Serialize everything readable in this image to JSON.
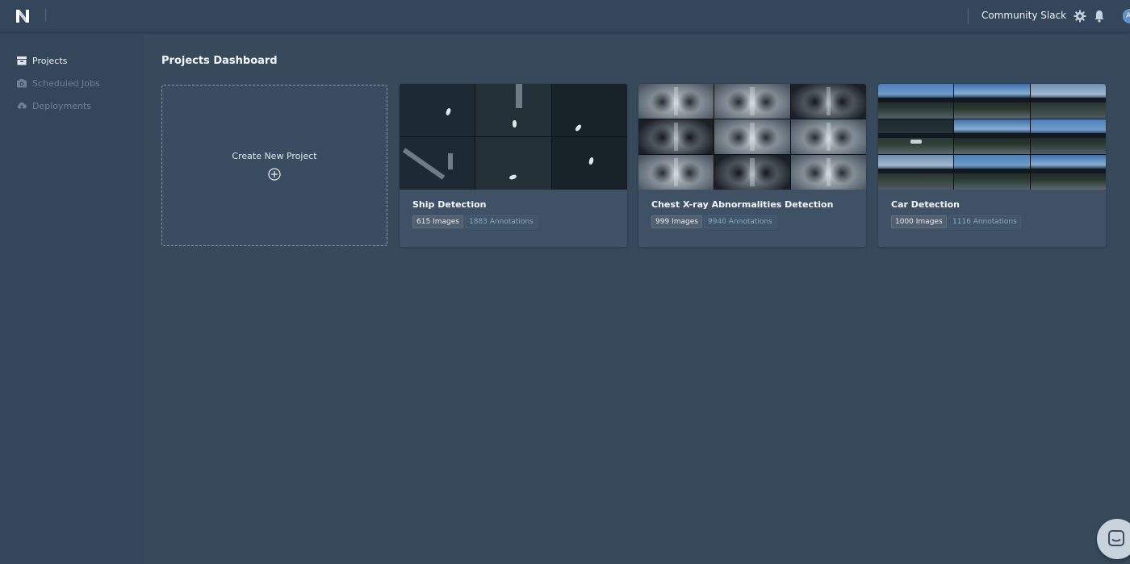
{
  "app": {
    "logo_letter": "N"
  },
  "topbar": {
    "community_label": "Community Slack",
    "avatar_initial": "A"
  },
  "sidebar": {
    "items": [
      {
        "label": "Projects",
        "icon": "inbox-icon",
        "active": true
      },
      {
        "label": "Scheduled Jobs",
        "icon": "camera-icon",
        "active": false
      },
      {
        "label": "Deployments",
        "icon": "cloud-upload-icon",
        "active": false
      }
    ]
  },
  "main": {
    "title": "Projects Dashboard",
    "create_card": {
      "label": "Create New Project",
      "icon": "plus-circle-icon"
    },
    "projects": [
      {
        "name": "Ship Detection",
        "images": "615 Images",
        "annotations": "1883 Annotations",
        "thumbnail": "aerial-ship-mosaic"
      },
      {
        "name": "Chest X-ray Abnormalities Detection",
        "images": "999 Images",
        "annotations": "9940 Annotations",
        "thumbnail": "chest-xray-mosaic"
      },
      {
        "name": "Car Detection",
        "images": "1000 Images",
        "annotations": "1116 Annotations",
        "thumbnail": "street-scene-mosaic"
      }
    ]
  },
  "colors": {
    "background": "#374a5c",
    "topbar": "#33465a",
    "sidebar": "#33465a",
    "card": "#3f5265",
    "annotation_text": "#8ea6bc",
    "avatar": "#5f8fc7"
  }
}
